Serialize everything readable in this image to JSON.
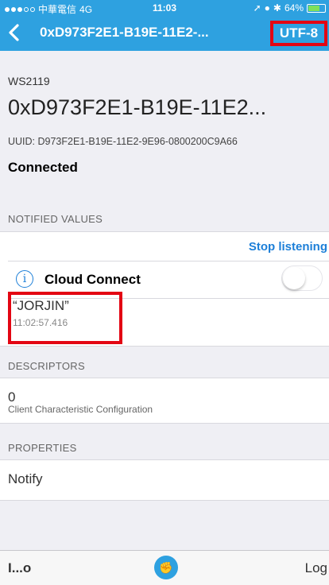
{
  "status_bar": {
    "carrier": "中華電信",
    "network": "4G",
    "time": "11:03",
    "battery": "64%",
    "battery_level": 0.64
  },
  "nav": {
    "title": "0xD973F2E1-B19E-11E2-...",
    "encoding_button": "UTF-8"
  },
  "device": {
    "name": "WS2119",
    "characteristic_title": "0xD973F2E1-B19E-11E2...",
    "uuid_line": "UUID: D973F2E1-B19E-11E2-9E96-0800200C9A66",
    "state": "Connected"
  },
  "notified": {
    "section_title": "NOTIFIED VALUES",
    "stop_label": "Stop listening",
    "cloud_label": "Cloud Connect",
    "cloud_enabled": false,
    "value": "“JORJIN”",
    "timestamp": "11:02:57.416"
  },
  "descriptors": {
    "section_title": "DESCRIPTORS",
    "value": "0",
    "name": "Client Characteristic Configuration"
  },
  "properties": {
    "section_title": "PROPERTIES",
    "value": "Notify"
  },
  "toolbar": {
    "left": "I...o",
    "right": "Log"
  },
  "colors": {
    "nav_bg": "#2ea1e0",
    "accent": "#1d7fd8",
    "highlight": "#e30613"
  }
}
